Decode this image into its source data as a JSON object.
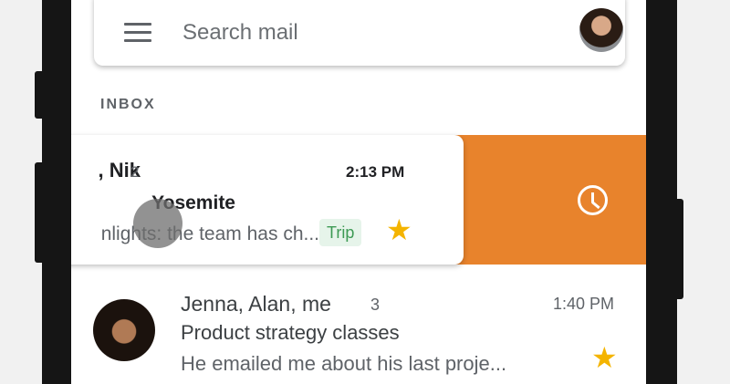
{
  "search": {
    "placeholder": "Search mail"
  },
  "section_label": "INBOX",
  "swiped_email": {
    "sender": ", Nik",
    "count": "2",
    "time": "2:13 PM",
    "subject": "Yosemite",
    "snippet": "nlights: the team has ch...",
    "label": "Trip",
    "star": "★",
    "swipe_action_icon": "clock-icon"
  },
  "email": {
    "sender": "Jenna, Alan, me",
    "count": "3",
    "time": "1:40 PM",
    "subject": "Product strategy classes",
    "snippet": "He emailed me about his last proje...",
    "star": "★"
  },
  "colors": {
    "swipe_action": "#e8832c",
    "star": "#f4b400",
    "label_bg": "#e6f4ea",
    "label_text": "#3d9a54"
  }
}
